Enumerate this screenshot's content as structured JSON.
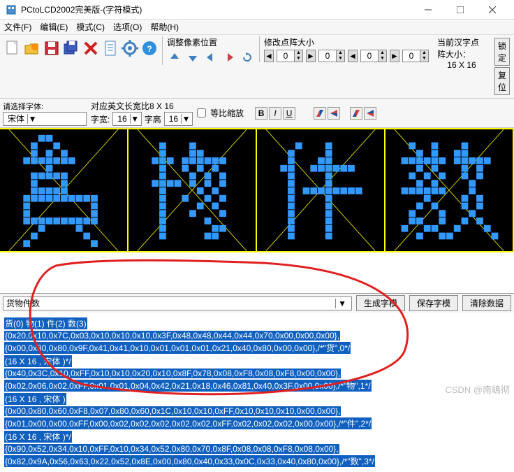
{
  "window": {
    "title": "PCtoLCD2002完美版-(字符模式)"
  },
  "menu": {
    "file": "文件(F)",
    "edit": "编辑(E)",
    "mode": "模式(C)",
    "options": "选项(O)",
    "help": "帮助(H)"
  },
  "toolbar": {
    "font_info_label": "对应英文长宽比",
    "font_info_value": "8 X 16",
    "adjust_group": "调整像素位置",
    "dotmatrix_group": "修改点阵大小",
    "current_size_label": "当前汉字点阵大小：",
    "current_size_value": "16 X 16",
    "lock": "锁定",
    "reset": "复位"
  },
  "spin": {
    "a": "0",
    "b": "0",
    "c": "0",
    "d": "0"
  },
  "row2": {
    "font_select_label": "请选择字体:",
    "font_name": "宋体",
    "char_width_label": "字宽:",
    "char_width": "16",
    "char_height_label": "字高",
    "char_height": "16",
    "scale_label": "等比缩放",
    "b": "B",
    "i": "I",
    "u": "U"
  },
  "bottom": {
    "input_value": "货物件数",
    "gen": "生成字模",
    "save": "保存字模",
    "clear": "清除数据"
  },
  "output": {
    "header": "货(0) 物(1) 件(2) 数(3)",
    "lines": [
      "{0x20,0x10,0x7C,0x03,0x10,0x10,0x10,0x3F,0x48,0x48,0x44,0x44,0x70,0x00,0x00,0x00},",
      "{0x00,0x80,0x80,0x9F,0x41,0x41,0x10,0x01,0x01,0x01,0x21,0x40,0x80,0x00,0x00},/*\"货\",0*/",
      "(16 X 16 , 宋体 )*/",
      "{0x40,0x3C,0x10,0xFF,0x10,0x10,0x20,0x10,0x8F,0x78,0x08,0xF8,0x08,0xF8,0x00,0x00},",
      "{0x02,0x06,0x02,0xFF,0x01,0x01,0x04,0x42,0x21,0x18,0x46,0x81,0x40,0x3F,0x00,0x00},/*\"物\",1*/",
      "(16 X 16 , 宋体 )",
      "{0x00,0x80,0x60,0xF8,0x07,0x80,0x60,0x1C,0x10,0x10,0xFF,0x10,0x10,0x10,0x00,0x00},",
      "{0x01,0x00,0x00,0xFF,0x00,0x02,0x02,0x02,0x02,0x02,0xFF,0x02,0x02,0x02,0x00,0x00},/*\"件\",2*/",
      "(16 X 16 , 宋体 )*/",
      "{0x90,0x52,0x34,0x10,0xFF,0x10,0x34,0x52,0x80,0x70,0x8F,0x08,0x08,0xF8,0x08,0x00},",
      "{0x82,0x9A,0x56,0x63,0x22,0x52,0x8E,0x00,0x80,0x40,0x33,0x0C,0x33,0x40,0x80,0x00},/*\"数\",3*/"
    ]
  },
  "watermark": "CSDN @南嶋彻"
}
